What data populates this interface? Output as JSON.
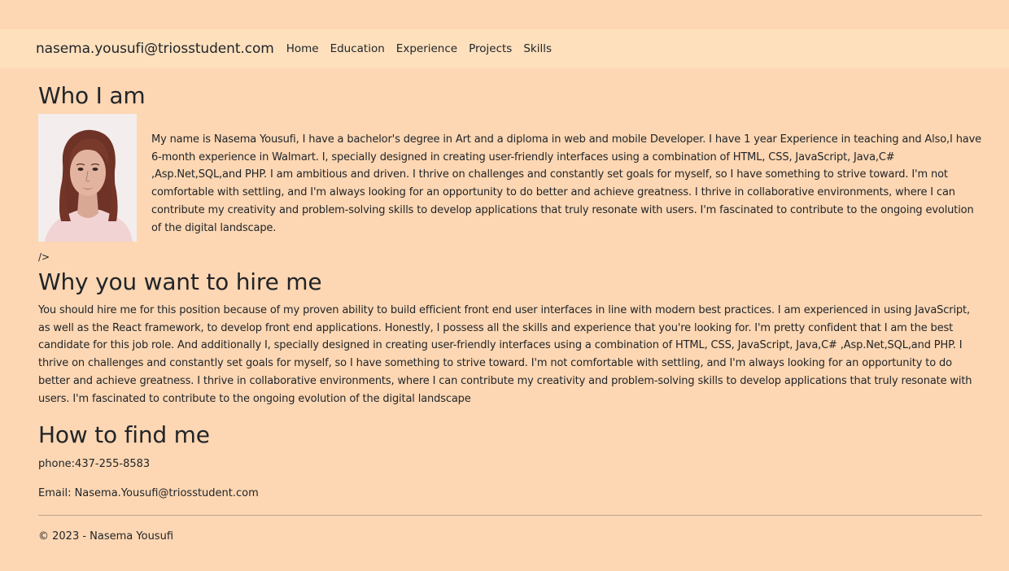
{
  "nav": {
    "brand": "nasema.yousufi@triosstudent.com",
    "links": [
      "Home",
      "Education",
      "Experience",
      "Projects",
      "Skills"
    ]
  },
  "who": {
    "title": "Who I am",
    "bio": "My name is Nasema Yousufi, I have a bachelor's degree in Art and a diploma in web and mobile Developer. I have 1 year Experience in teaching and Also,I have 6-month experience in Walmart. I, specially designed in creating user-friendly interfaces using a combination of HTML, CSS, JavaScript, Java,C# ,Asp.Net,SQL,and PHP. I am ambitious and driven. I thrive on challenges and constantly set goals for myself, so I have something to strive toward. I'm not comfortable with settling, and I'm always looking for an opportunity to do better and achieve greatness. I thrive in collaborative environments, where I can contribute my creativity and problem-solving skills to develop applications that truly resonate with users. I'm fascinated to contribute to the ongoing evolution of the digital landscape.",
    "stray_text": "/>"
  },
  "hire": {
    "title": "Why you want to hire me",
    "text": "You should hire me for this position because of my proven ability to build efficient front end user interfaces in line with modern best practices. I am experienced in using JavaScript, as well as the React framework, to develop front end applications. Honestly, I possess all the skills and experience that you're looking for. I'm pretty confident that I am the best candidate for this job role. And additionally I, specially designed in creating user-friendly interfaces using a combination of HTML, CSS, JavaScript, Java,C# ,Asp.Net,SQL,and PHP. I thrive on challenges and constantly set goals for myself, so I have something to strive toward. I'm not comfortable with settling, and I'm always looking for an opportunity to do better and achieve greatness. I thrive in collaborative environments, where I can contribute my creativity and problem-solving skills to develop applications that truly resonate with users. I'm fascinated to contribute to the ongoing evolution of the digital landscape"
  },
  "find": {
    "title": "How to find me",
    "phone": "phone:437-255-8583",
    "email": "Email: Nasema.Yousufi@triosstudent.com"
  },
  "footer": {
    "text": "© 2023 - Nasema Yousufi"
  },
  "colors": {
    "page_background": "#fdd7b3",
    "navbar_background": "#fee0bd",
    "text": "#212529"
  }
}
